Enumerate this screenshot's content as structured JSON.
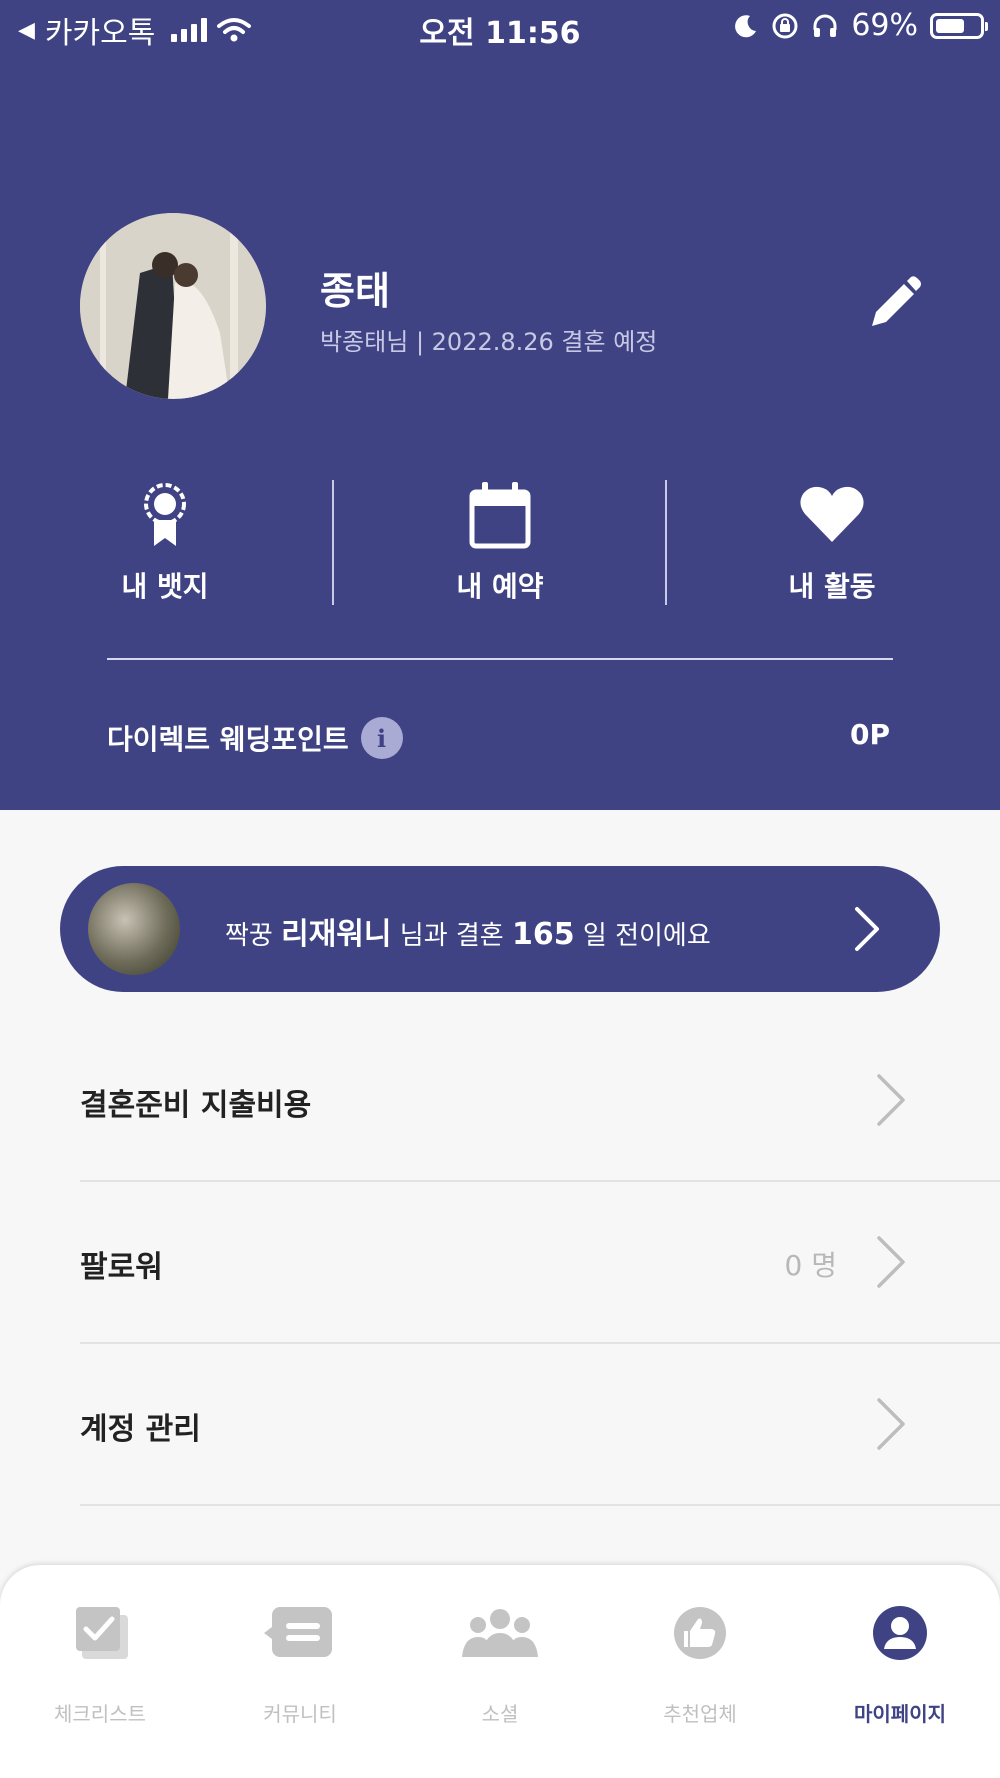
{
  "status_bar": {
    "back_label": "카카오톡",
    "time": "오전 11:56",
    "battery": "69%"
  },
  "profile": {
    "name": "종태",
    "subtitle": "박종태님 | 2022.8.26 결혼 예정"
  },
  "quick_actions": [
    {
      "label": "내 뱃지",
      "icon": "badge-icon"
    },
    {
      "label": "내 예약",
      "icon": "calendar-icon"
    },
    {
      "label": "내 활동",
      "icon": "heart-icon"
    }
  ],
  "points": {
    "label": "다이렉트 웨딩포인트",
    "value": "0P"
  },
  "partner_banner": {
    "prefix": "짝꿍 ",
    "partner_name": "리재워니",
    "middle": " 님과 결혼 ",
    "days": "165",
    "suffix": " 일 전이에요"
  },
  "menu": [
    {
      "label": "결혼준비 지출비용",
      "value": ""
    },
    {
      "label": "팔로워",
      "value": "0 명"
    },
    {
      "label": "계정 관리",
      "value": ""
    }
  ],
  "tabs": [
    {
      "label": "체크리스트",
      "icon": "checklist-icon"
    },
    {
      "label": "커뮤니티",
      "icon": "community-icon"
    },
    {
      "label": "소셜",
      "icon": "social-icon"
    },
    {
      "label": "추천업체",
      "icon": "recommend-icon"
    },
    {
      "label": "마이페이지",
      "icon": "profile-icon"
    }
  ],
  "active_tab": "마이페이지",
  "colors": {
    "brand": "#3f4384",
    "background": "#f7f7f7",
    "inactive_tab": "#c0c0c0"
  }
}
